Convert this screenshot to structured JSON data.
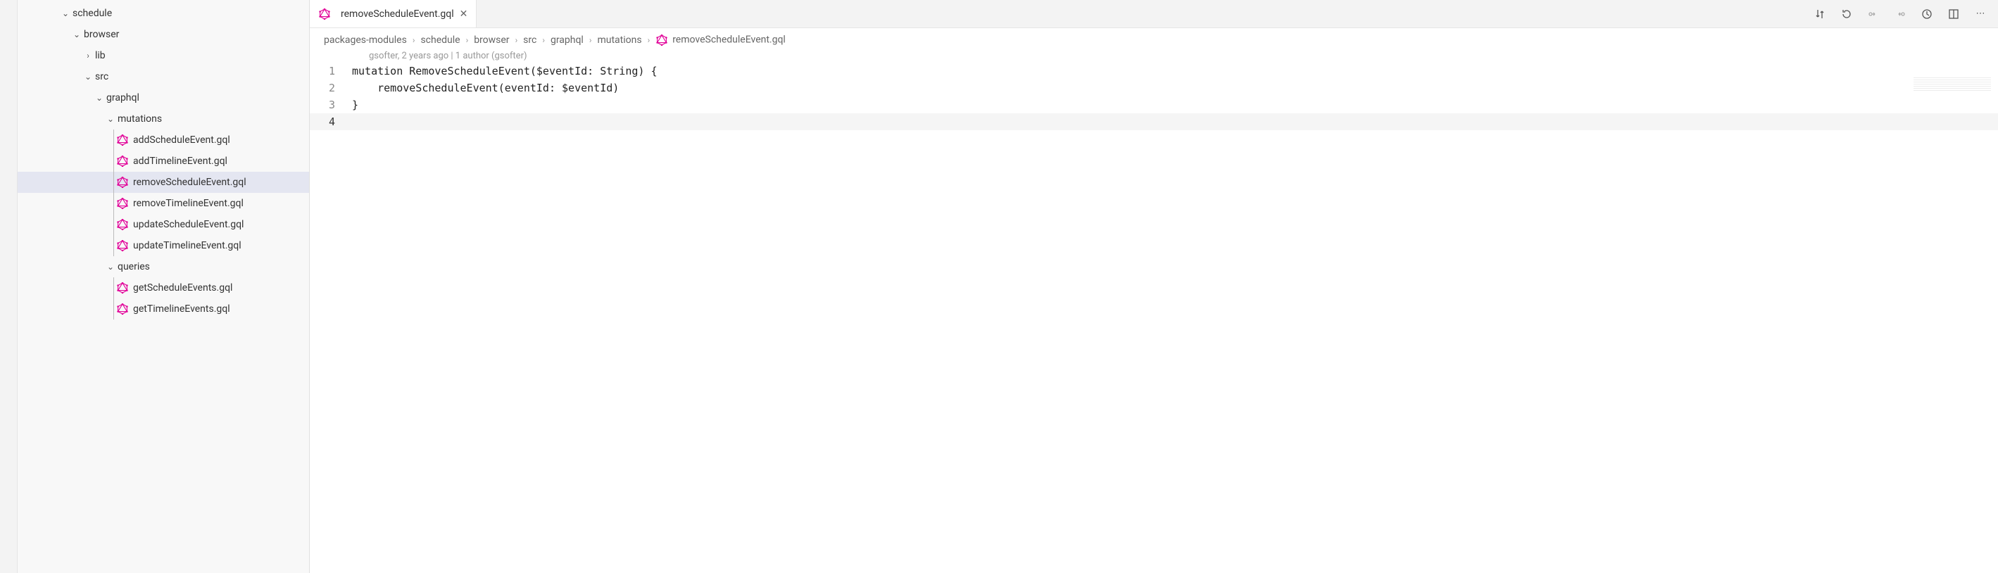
{
  "explorer": {
    "tree": [
      {
        "depth": 0,
        "kind": "folder",
        "open": true,
        "label": "schedule"
      },
      {
        "depth": 1,
        "kind": "folder",
        "open": true,
        "label": "browser"
      },
      {
        "depth": 2,
        "kind": "folder",
        "open": false,
        "label": "lib"
      },
      {
        "depth": 2,
        "kind": "folder",
        "open": true,
        "label": "src"
      },
      {
        "depth": 3,
        "kind": "folder",
        "open": true,
        "label": "graphql"
      },
      {
        "depth": 4,
        "kind": "folder",
        "open": true,
        "label": "mutations"
      },
      {
        "depth": 5,
        "kind": "file",
        "icon": "gql",
        "label": "addScheduleEvent.gql"
      },
      {
        "depth": 5,
        "kind": "file",
        "icon": "gql",
        "label": "addTimelineEvent.gql"
      },
      {
        "depth": 5,
        "kind": "file",
        "icon": "gql",
        "label": "removeScheduleEvent.gql",
        "selected": true
      },
      {
        "depth": 5,
        "kind": "file",
        "icon": "gql",
        "label": "removeTimelineEvent.gql"
      },
      {
        "depth": 5,
        "kind": "file",
        "icon": "gql",
        "label": "updateScheduleEvent.gql"
      },
      {
        "depth": 5,
        "kind": "file",
        "icon": "gql",
        "label": "updateTimelineEvent.gql"
      },
      {
        "depth": 4,
        "kind": "folder",
        "open": true,
        "label": "queries"
      },
      {
        "depth": 5,
        "kind": "file",
        "icon": "gql",
        "label": "getScheduleEvents.gql"
      },
      {
        "depth": 5,
        "kind": "file",
        "icon": "gql",
        "label": "getTimelineEvents.gql"
      }
    ]
  },
  "tab": {
    "label": "removeScheduleEvent.gql"
  },
  "breadcrumbs": [
    "packages-modules",
    "schedule",
    "browser",
    "src",
    "graphql",
    "mutations",
    "removeScheduleEvent.gql"
  ],
  "codeMeta": "gsofter, 2 years ago | 1 author (gsofter)",
  "code": {
    "lines": [
      "mutation RemoveScheduleEvent($eventId: String) {",
      "    removeScheduleEvent(eventId: $eventId)",
      "}",
      ""
    ],
    "currentLine": 4
  }
}
